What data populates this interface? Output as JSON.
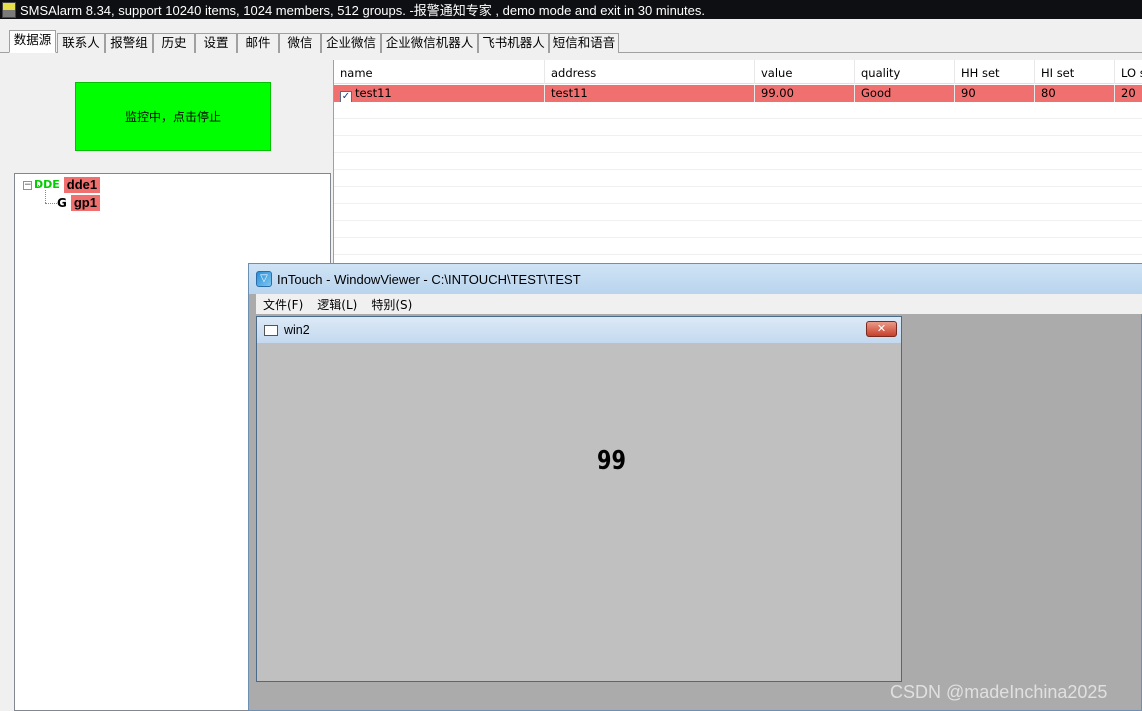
{
  "app": {
    "title": "SMSAlarm 8.34, support 10240 items, 1024 members, 512 groups. -报警通知专家 , demo mode and exit in 30 minutes."
  },
  "tabs": [
    {
      "label": "数据源",
      "active": true
    },
    {
      "label": "联系人"
    },
    {
      "label": "报警组"
    },
    {
      "label": "历史"
    },
    {
      "label": "设置"
    },
    {
      "label": "邮件"
    },
    {
      "label": "微信"
    },
    {
      "label": "企业微信"
    },
    {
      "label": "企业微信机器人"
    },
    {
      "label": "飞书机器人"
    },
    {
      "label": "短信和语音"
    }
  ],
  "monitor_button": {
    "label": "监控中，点击停止",
    "color": "#00ff00"
  },
  "tree": {
    "nodes": [
      {
        "label": "dde1",
        "icon": "dde-icon",
        "icon_text": "DDE"
      },
      {
        "label": "gp1",
        "icon": "group-icon",
        "icon_text": "G"
      }
    ]
  },
  "grid": {
    "columns": [
      "name",
      "address",
      "value",
      "quality",
      "HH set",
      "HI set",
      "LO se"
    ],
    "rows": [
      {
        "checked": true,
        "cells": [
          "test11",
          "test11",
          "99.00",
          "Good",
          "90",
          "80",
          "20"
        ]
      }
    ],
    "selected_color": "#f07070"
  },
  "intouch": {
    "title": "InTouch - WindowViewer - C:\\INTOUCH\\TEST\\TEST",
    "menu": [
      "文件(F)",
      "逻辑(L)",
      "特别(S)"
    ],
    "window": {
      "title": "win2",
      "close_label": "✕",
      "value": "99"
    }
  },
  "watermark": "CSDN @madeInchina2025"
}
